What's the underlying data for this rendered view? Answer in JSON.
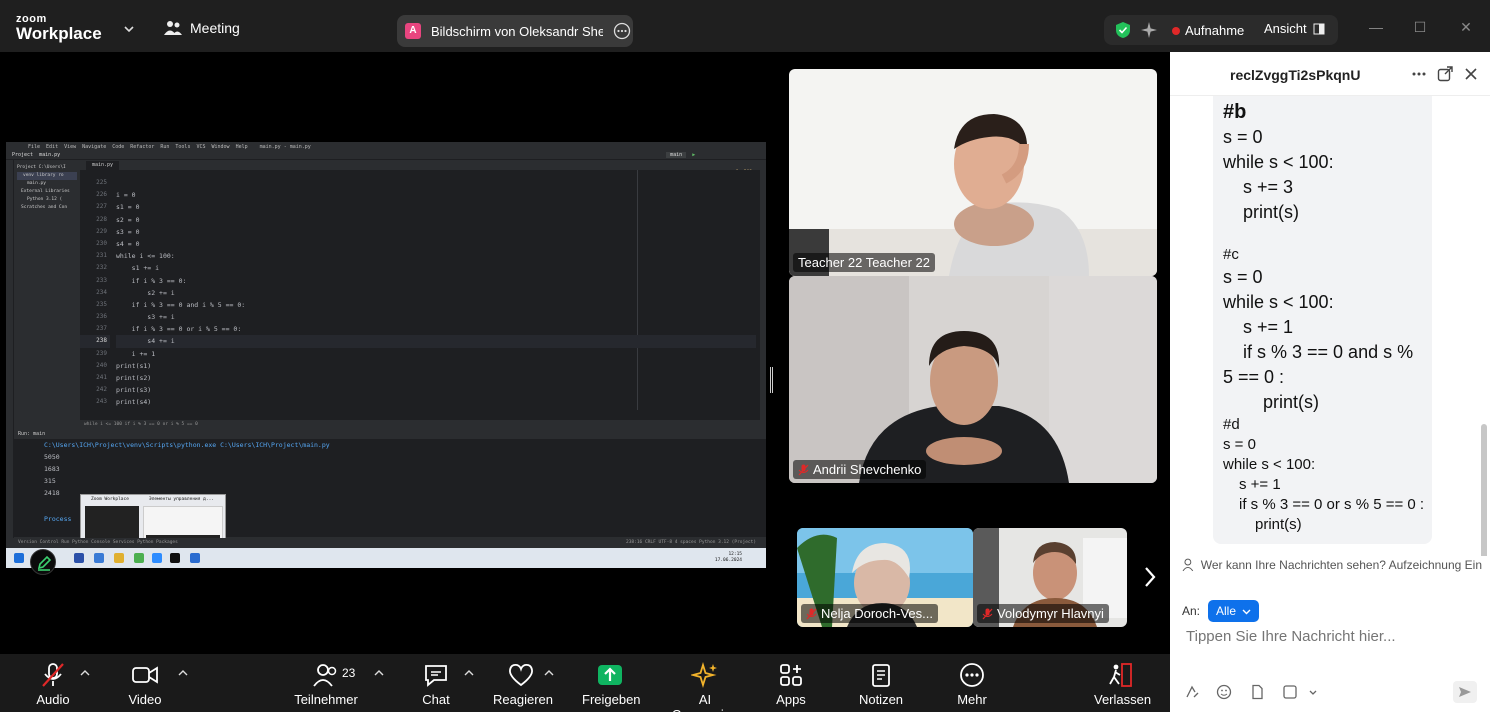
{
  "titlebar": {
    "logo_line1": "zoom",
    "logo_line2": "Workplace",
    "meeting_label": "Meeting",
    "share_avatar": "A",
    "share_title": "Bildschirm von Oleksandr Shevchenko",
    "recording_label": "Aufnahme",
    "view_label": "Ansicht"
  },
  "ide": {
    "menu": [
      "File",
      "Edit",
      "View",
      "Navigate",
      "Code",
      "Refactor",
      "Run",
      "Tools",
      "VCS",
      "Window",
      "Help",
      "main.py - main.py"
    ],
    "project_label": "Project",
    "file_label": "main.py",
    "tab": "main.py",
    "run_config": "main",
    "tree": [
      "Project C:\\Users\\I",
      "venv library ro",
      "main.py",
      "External Libraries",
      "Python 3.12 (",
      "Scratches and Con"
    ],
    "line_numbers": [
      "225",
      "226",
      "227",
      "228",
      "229",
      "230",
      "231",
      "232",
      "233",
      "234",
      "235",
      "236",
      "237",
      "238",
      "239",
      "240",
      "241",
      "242",
      "243"
    ],
    "code": {
      "l0": "",
      "l1": "i = 0",
      "l2": "s1 = 0",
      "l3": "s2 = 0",
      "l4": "s3 = 0",
      "l5": "s4 = 0",
      "l6": "while i <= 100:",
      "l7": "    s1 += i",
      "l8": "    if i % 3 == 0:",
      "l9": "        s2 += i",
      "l10": "    if i % 3 == 0 and i % 5 == 0:",
      "l11": "        s3 += i",
      "l12": "    if i % 3 == 0 or i % 5 == 0:",
      "l13": "        s4 += i",
      "l14": "    i += 1",
      "l15": "print(s1)",
      "l16": "print(s2)",
      "l17": "print(s3)",
      "l18": "print(s4)"
    },
    "inspections": "⚠9 ✓208",
    "breadcrumb": "while i <= 100    if i % 3 == 0 or i % 5 == 0",
    "run_tab": "Run:   main",
    "run_cmd": "C:\\Users\\ICH\\Project\\venv\\Scripts\\python.exe C:\\Users\\ICH\\Project\\main.py",
    "outputs": [
      "5050",
      "1683",
      "315",
      "2418"
    ],
    "process": "Process",
    "popup_titles": [
      "Zoom Workplace",
      "Элементы управления д..."
    ],
    "status_left": "Version Control   Run   Python Console   Services   Python Packages",
    "status_right": "238:16   CRLF   UTF-8   4 spaces   Python 3.12 (Project)",
    "clock_time": "12:15",
    "clock_date": "17.06.2024"
  },
  "participants": [
    {
      "name": "Teacher 22 Teacher 22",
      "muted": false
    },
    {
      "name": "Andrii Shevchenko",
      "muted": true
    },
    {
      "name": "Nelja Doroch-Ves...",
      "muted": true
    },
    {
      "name": "Volodymyr Hlavnyi",
      "muted": true
    }
  ],
  "chat": {
    "title": "reclZvggTi2sPkqnU",
    "message": {
      "b_head": "#b",
      "b1": "s = 0",
      "b2": "while s < 100:",
      "b3": "s += 3",
      "b4": "print(s)",
      "c_head": "#c",
      "c1": "s = 0",
      "c2": "while s < 100:",
      "c3": "s += 1",
      "c4": "if s % 3 == 0 and s %",
      "c5": "5 == 0 :",
      "c6": "print(s)",
      "d_head": "#d",
      "d1": "s = 0",
      "d2": "while s < 100:",
      "d3": "s += 1",
      "d4": "if s % 3 == 0 or s % 5 == 0 :",
      "d5": "print(s)"
    },
    "privacy_note": "Wer kann Ihre Nachrichten sehen? Aufzeichnung Ein",
    "to_label": "An:",
    "recipient": "Alle",
    "input_placeholder": "Tippen Sie Ihre Nachricht hier..."
  },
  "toolbar": {
    "audio": "Audio",
    "video": "Video",
    "participants": "Teilnehmer",
    "participants_count": "23",
    "chat": "Chat",
    "react": "Reagieren",
    "share": "Freigeben",
    "ai": "AI Companion",
    "apps": "Apps",
    "notes": "Notizen",
    "more": "Mehr",
    "leave": "Verlassen"
  },
  "colors": {
    "share_green": "#0fb461",
    "leave_red": "#e02828",
    "chat_blue": "#0e71eb",
    "ai_gold": "#f2b32b"
  }
}
